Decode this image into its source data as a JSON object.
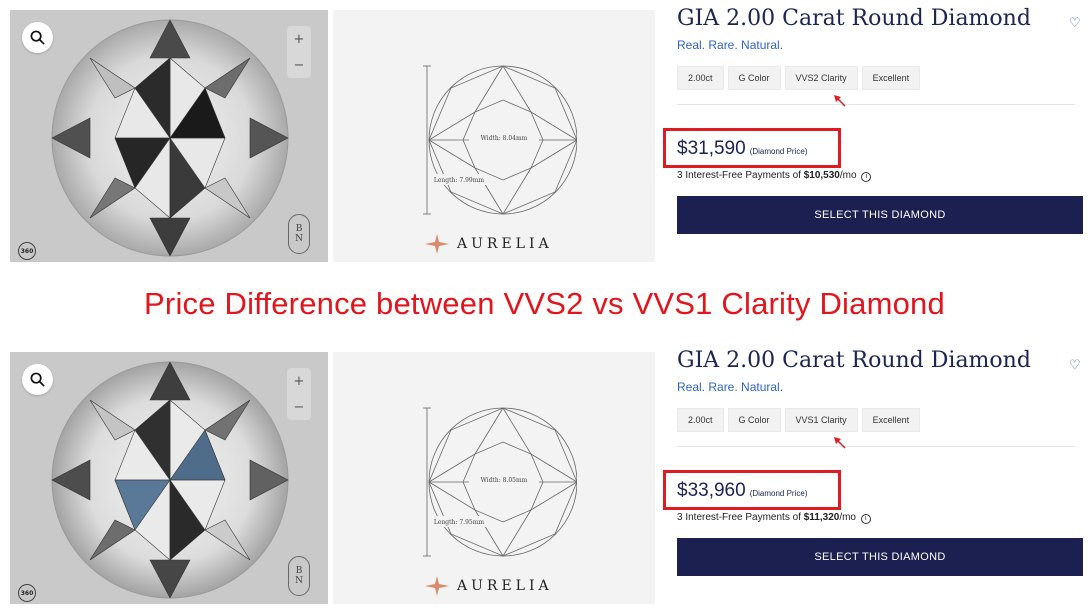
{
  "heading": "Price Difference between VVS2 vs VVS1 Clarity Diamond",
  "colors": {
    "heading": "#e4141c",
    "highlight": "#e11b22",
    "button": "#1c2050",
    "title": "#1b2452",
    "subtitle": "#2f63c8"
  },
  "listings": [
    {
      "title": "GIA 2.00 Carat Round Diamond",
      "subtitle": "Real. Rare. Natural.",
      "chips": [
        "2.00ct",
        "G Color",
        "VVS2 Clarity",
        "Excellent"
      ],
      "price": "$31,590",
      "price_note": "(Diamond Price)",
      "payments_prefix": "3 Interest-Free Payments of ",
      "payments_amount": "$10,530",
      "payments_suffix": "/mo",
      "button": "SELECT THIS DIAMOND",
      "width_label": "Width: 8.04mm",
      "length_label": "Length: 7.99mm",
      "brand": "AURELIA",
      "badge": "360",
      "logo": [
        "B",
        "N"
      ],
      "zoom": [
        "+",
        "−"
      ],
      "heart_icon": "heart-icon"
    },
    {
      "title": "GIA 2.00 Carat Round Diamond",
      "subtitle": "Real. Rare. Natural.",
      "chips": [
        "2.00ct",
        "G Color",
        "VVS1 Clarity",
        "Excellent"
      ],
      "price": "$33,960",
      "price_note": "(Diamond Price)",
      "payments_prefix": "3 Interest-Free Payments of ",
      "payments_amount": "$11,320",
      "payments_suffix": "/mo",
      "button": "SELECT THIS DIAMOND",
      "width_label": "Width: 8.05mm",
      "length_label": "Length: 7.95mm",
      "brand": "AURELIA",
      "badge": "360",
      "logo": [
        "B",
        "N"
      ],
      "zoom": [
        "+",
        "−"
      ],
      "heart_icon": "heart-icon"
    }
  ]
}
